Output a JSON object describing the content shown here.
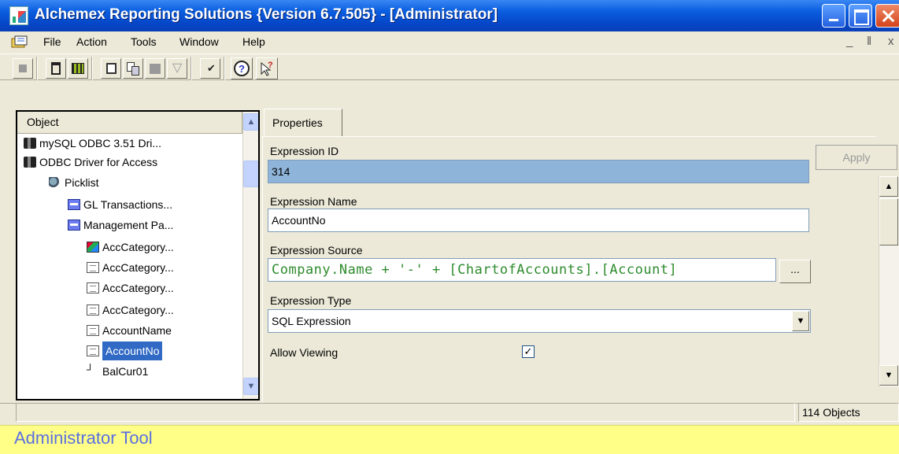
{
  "window": {
    "title": "Alchemex Reporting Solutions {Version 6.7.505} - [Administrator]"
  },
  "menu": {
    "items": [
      "File",
      "Action",
      "Tools",
      "Window",
      "Help"
    ],
    "mdi_controls": [
      "_",
      "ǁ",
      "x"
    ]
  },
  "toolbar": {
    "buttons": [
      "stop-icon",
      "delete-icon",
      "grid-icon",
      "refresh-icon",
      "copy-icon",
      "paste-icon",
      "filter-icon",
      "check-icon",
      "help-icon",
      "pointer-help-icon"
    ]
  },
  "tree": {
    "header": "Object",
    "items": [
      {
        "label": "mySQL ODBC 3.51 Dri...",
        "icon": "odbc-driver-icon",
        "indent": 0
      },
      {
        "label": "ODBC Driver for Access",
        "icon": "odbc-driver-icon",
        "indent": 0
      },
      {
        "label": "Picklist",
        "icon": "picklist-icon",
        "indent": 1
      },
      {
        "label": "GL Transactions...",
        "icon": "table-icon",
        "indent": 2
      },
      {
        "label": "Management Pa...",
        "icon": "table-icon",
        "indent": 2
      },
      {
        "label": "AccCategory...",
        "icon": "category-icon",
        "indent": 3
      },
      {
        "label": "AccCategory...",
        "icon": "document-icon",
        "indent": 3
      },
      {
        "label": "AccCategory...",
        "icon": "document-icon",
        "indent": 3
      },
      {
        "label": "AccCategory...",
        "icon": "document-icon",
        "indent": 3
      },
      {
        "label": "AccountName",
        "icon": "document-icon",
        "indent": 3
      },
      {
        "label": "AccountNo",
        "icon": "document-icon",
        "indent": 3,
        "selected": true
      },
      {
        "label": "BalCur01",
        "icon": "field-icon",
        "indent": 3
      }
    ]
  },
  "properties": {
    "tab_label": "Properties",
    "expression_id_label": "Expression ID",
    "expression_id_value": "314",
    "expression_name_label": "Expression Name",
    "expression_name_value": "AccountNo",
    "expression_source_label": "Expression Source",
    "expression_source_value": "Company.Name + '-' + [ChartofAccounts].[Account]",
    "ellipsis_label": "...",
    "expression_type_label": "Expression Type",
    "expression_type_value": "SQL Expression",
    "allow_viewing_label": "Allow Viewing",
    "allow_viewing_checked": true,
    "apply_label": "Apply"
  },
  "status": {
    "objects_count": "114 Objects"
  },
  "footer": {
    "text": "Administrator Tool"
  }
}
